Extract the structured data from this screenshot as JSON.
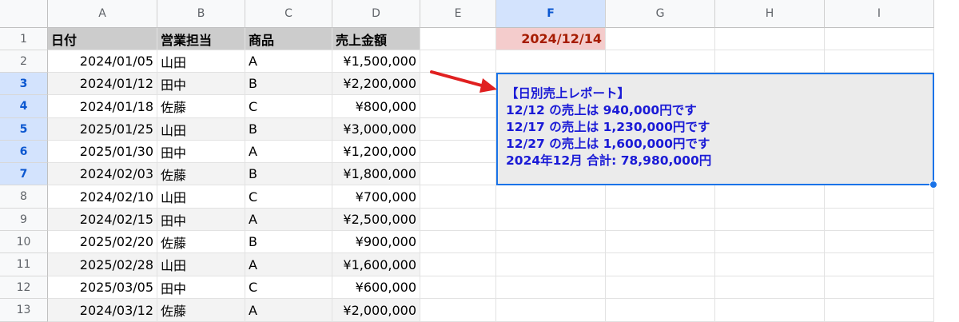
{
  "columns": [
    "A",
    "B",
    "C",
    "D",
    "E",
    "F",
    "G",
    "H",
    "I"
  ],
  "row_numbers": [
    "1",
    "2",
    "3",
    "4",
    "5",
    "6",
    "7",
    "8",
    "9",
    "10",
    "11",
    "12",
    "13"
  ],
  "header_row": {
    "a": "日付",
    "b": "営業担当",
    "c": "商品",
    "d": "売上金額"
  },
  "rows": [
    {
      "date": "2024/01/05",
      "rep": "山田",
      "product": "A",
      "amount": "¥1,500,000"
    },
    {
      "date": "2024/01/12",
      "rep": "田中",
      "product": "B",
      "amount": "¥2,200,000"
    },
    {
      "date": "2024/01/18",
      "rep": "佐藤",
      "product": "C",
      "amount": "¥800,000"
    },
    {
      "date": "2025/01/25",
      "rep": "山田",
      "product": "B",
      "amount": "¥3,000,000"
    },
    {
      "date": "2025/01/30",
      "rep": "田中",
      "product": "A",
      "amount": "¥1,200,000"
    },
    {
      "date": "2024/02/03",
      "rep": "佐藤",
      "product": "B",
      "amount": "¥1,800,000"
    },
    {
      "date": "2024/02/10",
      "rep": "山田",
      "product": "C",
      "amount": "¥700,000"
    },
    {
      "date": "2024/02/15",
      "rep": "田中",
      "product": "A",
      "amount": "¥2,500,000"
    },
    {
      "date": "2025/02/20",
      "rep": "佐藤",
      "product": "B",
      "amount": "¥900,000"
    },
    {
      "date": "2025/02/28",
      "rep": "山田",
      "product": "A",
      "amount": "¥1,600,000"
    },
    {
      "date": "2025/03/05",
      "rep": "田中",
      "product": "C",
      "amount": "¥600,000"
    },
    {
      "date": "2024/03/12",
      "rep": "佐藤",
      "product": "A",
      "amount": "¥2,000,000"
    }
  ],
  "f1_value": "2024/12/14",
  "report": {
    "lines": [
      "【日別売上レポート】",
      "12/12 の売上は 940,000円です",
      "12/17 の売上は 1,230,000円です",
      "12/27 の売上は 1,600,000円です",
      "2024年12月 合計: 78,980,000円"
    ]
  },
  "colors": {
    "header_fill": "#cccccc",
    "band_fill": "#f3f3f3",
    "f1_fill": "#f4cccc",
    "f1_text": "#a61c00",
    "report_text": "#1a1ad6",
    "selection": "#1a73e8",
    "arrow": "#e02020"
  }
}
